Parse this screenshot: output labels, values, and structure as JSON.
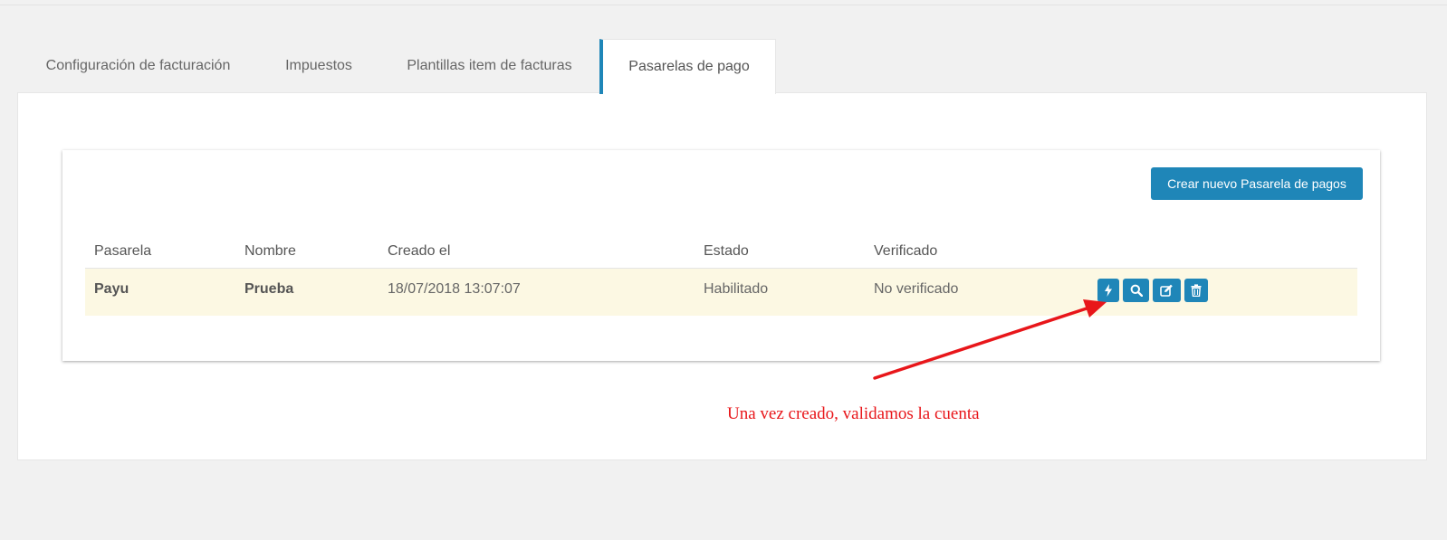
{
  "tabs": [
    {
      "label": "Configuración de facturación",
      "active": false
    },
    {
      "label": "Impuestos",
      "active": false
    },
    {
      "label": "Plantillas item de facturas",
      "active": false
    },
    {
      "label": "Pasarelas de pago",
      "active": true
    }
  ],
  "toolbar": {
    "create_label": "Crear nuevo Pasarela de pagos"
  },
  "table": {
    "headers": [
      "Pasarela",
      "Nombre",
      "Creado el",
      "Estado",
      "Verificado"
    ],
    "rows": [
      {
        "pasarela": "Payu",
        "nombre": "Prueba",
        "creado": "18/07/2018 13:07:07",
        "estado": "Habilitado",
        "verificado": "No verificado"
      }
    ],
    "row_actions": [
      "bolt-icon",
      "search-icon",
      "edit-icon",
      "trash-icon"
    ]
  },
  "annotation": {
    "text": "Una vez creado, validamos la cuenta",
    "color": "#e8161a"
  },
  "colors": {
    "accent": "#1f86b8",
    "row_highlight": "#fcf8e3",
    "background": "#f1f1f1"
  }
}
